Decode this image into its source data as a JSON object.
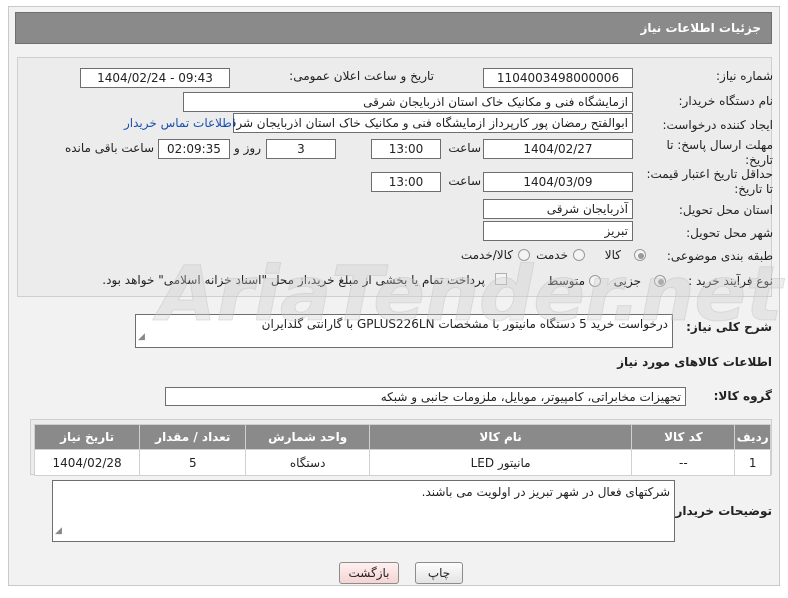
{
  "header": {
    "title": "جزئیات اطلاعات نیاز"
  },
  "form": {
    "need_number": {
      "label": "شماره نیاز:",
      "value": "1104003498000006"
    },
    "announce_datetime": {
      "label": "تاریخ و ساعت اعلان عمومی:",
      "value": "1404/02/24 - 09:43"
    },
    "buyer_org": {
      "label": "نام دستگاه خریدار:",
      "value": "ازمایشگاه فنی و مکانیک خاک استان اذربایجان شرقی"
    },
    "requester": {
      "label": "ایجاد کننده درخواست:",
      "value": "ابوالفتح رمضان پور کارپرداز ازمایشگاه فنی و مکانیک خاک استان اذربایجان شرقی",
      "contact_link": "اطلاعات تماس خریدار"
    },
    "reply_deadline": {
      "label_line1": "مهلت ارسال پاسخ: تا",
      "label_line2": "تاریخ:",
      "date": "1404/02/27",
      "time_label": "ساعت",
      "time": "13:00",
      "days": "3",
      "days_label": "روز و",
      "remaining": "02:09:35",
      "remaining_label": "ساعت باقی مانده"
    },
    "price_validity": {
      "label_line1": "حداقل تاریخ اعتبار قیمت:",
      "label_line2": "تا تاریخ:",
      "date": "1404/03/09",
      "time_label": "ساعت",
      "time": "13:00"
    },
    "delivery_province": {
      "label": "استان محل تحویل:",
      "value": "آذربایجان شرقی"
    },
    "delivery_city": {
      "label": "شهر محل تحویل:",
      "value": "تبریز"
    },
    "category": {
      "label": "طبقه بندی موضوعی:",
      "options": [
        "کالا",
        "خدمت",
        "کالا/خدمت"
      ],
      "selected": "کالا"
    },
    "purchase_type": {
      "label": "نوع فرآیند خرید :",
      "options": [
        "جزیی",
        "متوسط"
      ],
      "selected": "جزیی",
      "payment_note": "پرداخت تمام یا بخشی از مبلغ خرید،از محل \"اسناد خزانه اسلامی\" خواهد بود."
    }
  },
  "description": {
    "label": "شرح کلی نیاز:",
    "value": "درخواست خرید 5 دستگاه مانیتور با مشخصات GPLUS226LN با گارانتی گلدایران"
  },
  "goods_info": {
    "title": "اطلاعات کالاهای مورد نیاز",
    "group_label": "گروه کالا:",
    "group_value": "تجهیزات مخابراتی، کامپیوتر، موبایل، ملزومات جانبی و شبکه"
  },
  "table": {
    "columns": [
      "ردیف",
      "کد کالا",
      "نام کالا",
      "واحد شمارش",
      "تعداد / مقدار",
      "تاریخ نیاز"
    ],
    "rows": [
      [
        "1",
        "--",
        "مانیتور LED",
        "دستگاه",
        "5",
        "1404/02/28"
      ]
    ]
  },
  "buyer_notes": {
    "label": "توضیحات خریدار:",
    "value": "شرکتهای فعال در شهر تبریز در اولویت می باشند."
  },
  "buttons": {
    "print": "چاپ",
    "back": "بازگشت"
  },
  "watermark": {
    "text": "AriaTender.net"
  }
}
